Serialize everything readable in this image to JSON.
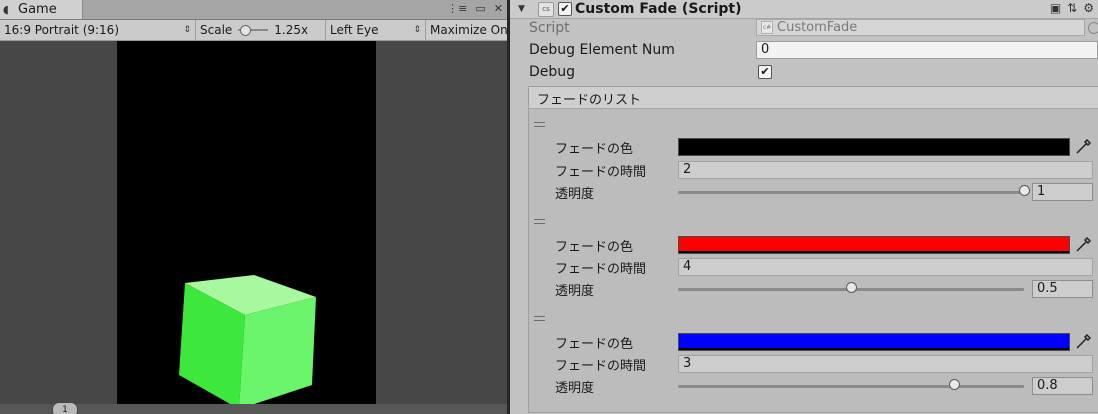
{
  "game": {
    "tab_label": "Game",
    "toolbar": {
      "aspect": "16:9 Portrait (9:16)",
      "scale_label": "Scale",
      "scale_value": "1.25x",
      "eye": "Left Eye",
      "maximize": "Maximize On"
    },
    "bottom_badge": "1",
    "cube_color": "#5ef05e",
    "canvas_color": "#000000"
  },
  "inspector": {
    "component_title": "Custom Fade (Script)",
    "script_label": "Script",
    "script_value": "CustomFade",
    "debug_num_label": "Debug Element Num",
    "debug_num_value": "0",
    "debug_label": "Debug",
    "debug_checked": true,
    "list_title": "フェードのリスト",
    "elements": [
      {
        "color_label": "フェードの色",
        "color": "#000000",
        "time_label": "フェードの時間",
        "time": "2",
        "alpha_label": "透明度",
        "alpha": "1",
        "alpha_fraction": 1.0
      },
      {
        "color_label": "フェードの色",
        "color": "#ff0000",
        "time_label": "フェードの時間",
        "time": "4",
        "alpha_label": "透明度",
        "alpha": "0.5",
        "alpha_fraction": 0.5
      },
      {
        "color_label": "フェードの色",
        "color": "#0000ff",
        "time_label": "フェードの時間",
        "time": "3",
        "alpha_label": "透明度",
        "alpha": "0.8",
        "alpha_fraction": 0.8
      }
    ]
  }
}
